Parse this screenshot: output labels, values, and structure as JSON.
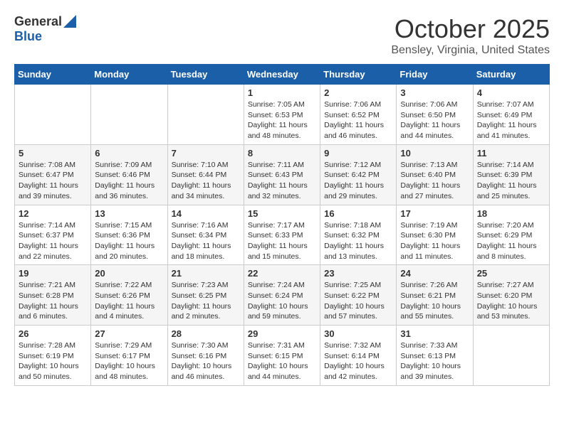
{
  "logo": {
    "general": "General",
    "blue": "Blue"
  },
  "title": "October 2025",
  "subtitle": "Bensley, Virginia, United States",
  "weekdays": [
    "Sunday",
    "Monday",
    "Tuesday",
    "Wednesday",
    "Thursday",
    "Friday",
    "Saturday"
  ],
  "weeks": [
    [
      {
        "day": "",
        "info": ""
      },
      {
        "day": "",
        "info": ""
      },
      {
        "day": "",
        "info": ""
      },
      {
        "day": "1",
        "info": "Sunrise: 7:05 AM\nSunset: 6:53 PM\nDaylight: 11 hours\nand 48 minutes."
      },
      {
        "day": "2",
        "info": "Sunrise: 7:06 AM\nSunset: 6:52 PM\nDaylight: 11 hours\nand 46 minutes."
      },
      {
        "day": "3",
        "info": "Sunrise: 7:06 AM\nSunset: 6:50 PM\nDaylight: 11 hours\nand 44 minutes."
      },
      {
        "day": "4",
        "info": "Sunrise: 7:07 AM\nSunset: 6:49 PM\nDaylight: 11 hours\nand 41 minutes."
      }
    ],
    [
      {
        "day": "5",
        "info": "Sunrise: 7:08 AM\nSunset: 6:47 PM\nDaylight: 11 hours\nand 39 minutes."
      },
      {
        "day": "6",
        "info": "Sunrise: 7:09 AM\nSunset: 6:46 PM\nDaylight: 11 hours\nand 36 minutes."
      },
      {
        "day": "7",
        "info": "Sunrise: 7:10 AM\nSunset: 6:44 PM\nDaylight: 11 hours\nand 34 minutes."
      },
      {
        "day": "8",
        "info": "Sunrise: 7:11 AM\nSunset: 6:43 PM\nDaylight: 11 hours\nand 32 minutes."
      },
      {
        "day": "9",
        "info": "Sunrise: 7:12 AM\nSunset: 6:42 PM\nDaylight: 11 hours\nand 29 minutes."
      },
      {
        "day": "10",
        "info": "Sunrise: 7:13 AM\nSunset: 6:40 PM\nDaylight: 11 hours\nand 27 minutes."
      },
      {
        "day": "11",
        "info": "Sunrise: 7:14 AM\nSunset: 6:39 PM\nDaylight: 11 hours\nand 25 minutes."
      }
    ],
    [
      {
        "day": "12",
        "info": "Sunrise: 7:14 AM\nSunset: 6:37 PM\nDaylight: 11 hours\nand 22 minutes."
      },
      {
        "day": "13",
        "info": "Sunrise: 7:15 AM\nSunset: 6:36 PM\nDaylight: 11 hours\nand 20 minutes."
      },
      {
        "day": "14",
        "info": "Sunrise: 7:16 AM\nSunset: 6:34 PM\nDaylight: 11 hours\nand 18 minutes."
      },
      {
        "day": "15",
        "info": "Sunrise: 7:17 AM\nSunset: 6:33 PM\nDaylight: 11 hours\nand 15 minutes."
      },
      {
        "day": "16",
        "info": "Sunrise: 7:18 AM\nSunset: 6:32 PM\nDaylight: 11 hours\nand 13 minutes."
      },
      {
        "day": "17",
        "info": "Sunrise: 7:19 AM\nSunset: 6:30 PM\nDaylight: 11 hours\nand 11 minutes."
      },
      {
        "day": "18",
        "info": "Sunrise: 7:20 AM\nSunset: 6:29 PM\nDaylight: 11 hours\nand 8 minutes."
      }
    ],
    [
      {
        "day": "19",
        "info": "Sunrise: 7:21 AM\nSunset: 6:28 PM\nDaylight: 11 hours\nand 6 minutes."
      },
      {
        "day": "20",
        "info": "Sunrise: 7:22 AM\nSunset: 6:26 PM\nDaylight: 11 hours\nand 4 minutes."
      },
      {
        "day": "21",
        "info": "Sunrise: 7:23 AM\nSunset: 6:25 PM\nDaylight: 11 hours\nand 2 minutes."
      },
      {
        "day": "22",
        "info": "Sunrise: 7:24 AM\nSunset: 6:24 PM\nDaylight: 10 hours\nand 59 minutes."
      },
      {
        "day": "23",
        "info": "Sunrise: 7:25 AM\nSunset: 6:22 PM\nDaylight: 10 hours\nand 57 minutes."
      },
      {
        "day": "24",
        "info": "Sunrise: 7:26 AM\nSunset: 6:21 PM\nDaylight: 10 hours\nand 55 minutes."
      },
      {
        "day": "25",
        "info": "Sunrise: 7:27 AM\nSunset: 6:20 PM\nDaylight: 10 hours\nand 53 minutes."
      }
    ],
    [
      {
        "day": "26",
        "info": "Sunrise: 7:28 AM\nSunset: 6:19 PM\nDaylight: 10 hours\nand 50 minutes."
      },
      {
        "day": "27",
        "info": "Sunrise: 7:29 AM\nSunset: 6:17 PM\nDaylight: 10 hours\nand 48 minutes."
      },
      {
        "day": "28",
        "info": "Sunrise: 7:30 AM\nSunset: 6:16 PM\nDaylight: 10 hours\nand 46 minutes."
      },
      {
        "day": "29",
        "info": "Sunrise: 7:31 AM\nSunset: 6:15 PM\nDaylight: 10 hours\nand 44 minutes."
      },
      {
        "day": "30",
        "info": "Sunrise: 7:32 AM\nSunset: 6:14 PM\nDaylight: 10 hours\nand 42 minutes."
      },
      {
        "day": "31",
        "info": "Sunrise: 7:33 AM\nSunset: 6:13 PM\nDaylight: 10 hours\nand 39 minutes."
      },
      {
        "day": "",
        "info": ""
      }
    ]
  ]
}
